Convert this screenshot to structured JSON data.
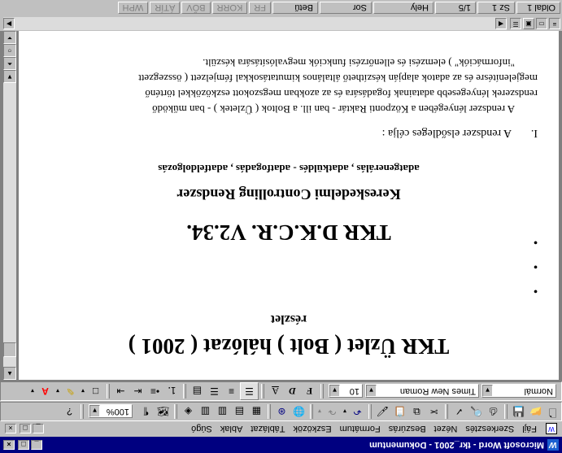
{
  "window": {
    "app_icon": "W",
    "title": "Microsoft Word - tkr_2001 - Dokumentum",
    "controls": [
      "_",
      "□",
      "×"
    ]
  },
  "menu": {
    "items": [
      "Fájl",
      "Szerkesztés",
      "Nézet",
      "Beszúrás",
      "Formátum",
      "Eszközök",
      "Táblázat",
      "Ablak",
      "Súgó"
    ],
    "doc_controls": [
      "_",
      "□",
      "×"
    ]
  },
  "standard_toolbar": {
    "zoom": "100%"
  },
  "formatting_toolbar": {
    "style": "Normál",
    "font": "Times New Roman",
    "size": "10",
    "bold": "F",
    "italic": "D",
    "underline": "A"
  },
  "document": {
    "title1": "TKR Üzlet ( Bolt ) hálózat ( 2001 )",
    "subtitle1": "részlet",
    "bullets": [
      "•",
      "•",
      "•"
    ],
    "title2": "TKR D.K.C.R. V2.34.",
    "subtitle2": "Kereskedelmi Controlling Rendszer",
    "subtitle3": "adatgenerálás ,   adatküldés - adatfogadás , adatfeldolgozás",
    "heading_num": "I.",
    "heading_text": "A rendszer elsődleges célja :",
    "para_lines": [
      "A rendszer lényegében a Központi Raktár - ban ill. a Boltok ( Üzletek ) - ban működő",
      "rendszerek lényegesebb adatainak fogadására és az azokban megszokott eszközökkel történő",
      "megjelenítésre és az adatok alapján készíthető általános kimutatásokkal fémjelzett ( összegzett",
      "\"információk\" ) elemzési és ellenőrzési funkciók megvalósítására készült."
    ]
  },
  "statusbar": {
    "page": "Oldal  1",
    "section": "Sz  1",
    "pages": "1/5",
    "pos": "Hely",
    "line": "Sor",
    "col": "Betű",
    "modes": [
      "FR",
      "KORR",
      "BŐV",
      "ÁTÍR",
      "WPH"
    ]
  }
}
